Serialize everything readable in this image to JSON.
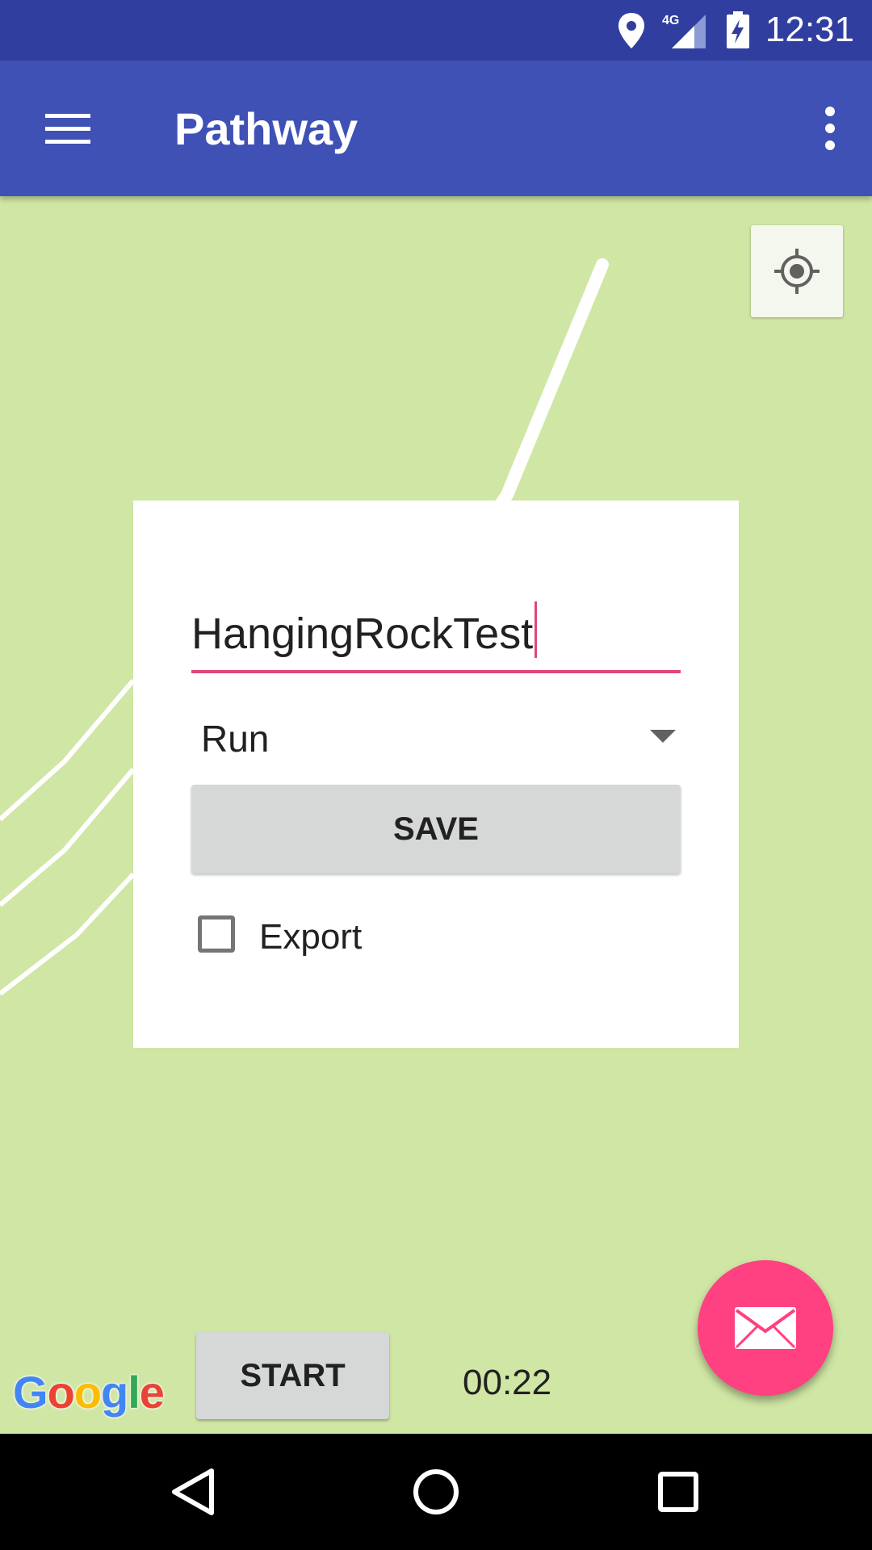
{
  "status_bar": {
    "time": "12:31",
    "network": "4G",
    "icons": [
      "location-icon",
      "signal-4g-icon",
      "battery-charging-icon"
    ]
  },
  "app_bar": {
    "title": "Pathway",
    "menu_icon": "hamburger-menu-icon",
    "overflow_icon": "more-vert-icon",
    "color": "#3f51b5",
    "status_color": "#303f9f"
  },
  "map": {
    "background": "#d0e6a5",
    "locate_icon": "my-location-icon",
    "attribution": "Google"
  },
  "dialog": {
    "name_value": "HangingRockTest",
    "activity_type": "Run",
    "save_label": "SAVE",
    "export_label": "Export",
    "export_checked": false,
    "accent": "#e0457b"
  },
  "controls": {
    "start_label": "START",
    "timer": "00:22"
  },
  "fab": {
    "icon": "email-icon",
    "color": "#ff4081"
  },
  "nav_bar": {
    "icons": [
      "back-icon",
      "home-icon",
      "recents-icon"
    ]
  }
}
